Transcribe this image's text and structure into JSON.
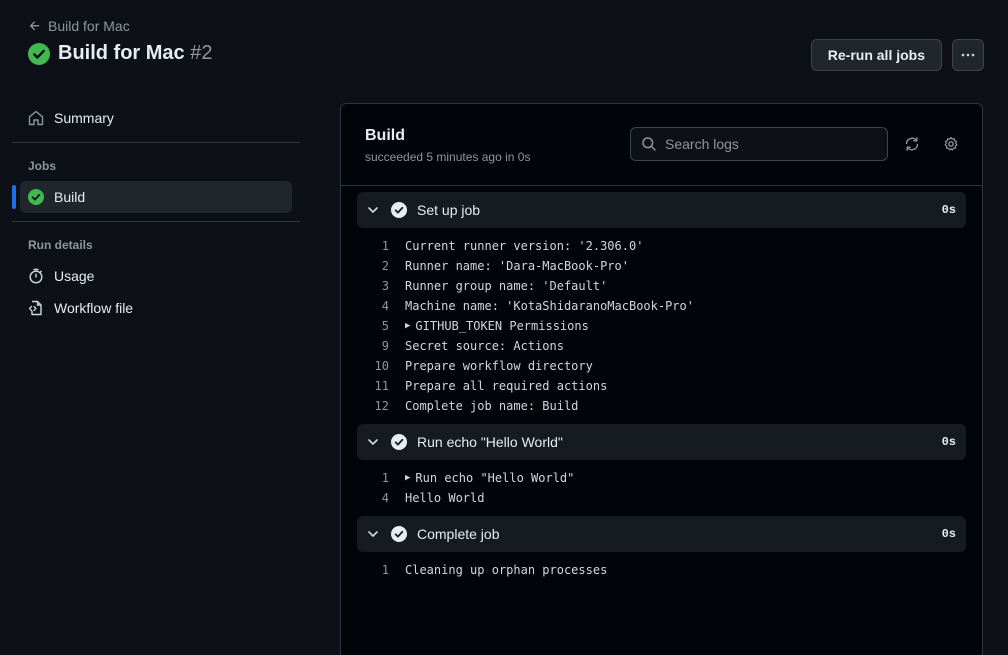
{
  "header": {
    "back_label": "Build for Mac",
    "title": "Build for Mac",
    "run_number": "#2",
    "rerun_label": "Re-run all jobs",
    "more_label": "···"
  },
  "sidebar": {
    "summary_label": "Summary",
    "jobs_heading": "Jobs",
    "job_label": "Build",
    "run_details_heading": "Run details",
    "usage_label": "Usage",
    "workflow_file_label": "Workflow file"
  },
  "job": {
    "title": "Build",
    "subtitle": "succeeded 5 minutes ago in 0s",
    "search_placeholder": "Search logs"
  },
  "steps": [
    {
      "name": "Set up job",
      "duration": "0s",
      "lines": [
        {
          "n": "1",
          "text": "Current runner version: '2.306.0'",
          "expandable": false
        },
        {
          "n": "2",
          "text": "Runner name: 'Dara-MacBook-Pro'",
          "expandable": false
        },
        {
          "n": "3",
          "text": "Runner group name: 'Default'",
          "expandable": false
        },
        {
          "n": "4",
          "text": "Machine name: 'KotaShidaranoMacBook-Pro'",
          "expandable": false
        },
        {
          "n": "5",
          "text": "GITHUB_TOKEN Permissions",
          "expandable": true
        },
        {
          "n": "9",
          "text": "Secret source: Actions",
          "expandable": false
        },
        {
          "n": "10",
          "text": "Prepare workflow directory",
          "expandable": false
        },
        {
          "n": "11",
          "text": "Prepare all required actions",
          "expandable": false
        },
        {
          "n": "12",
          "text": "Complete job name: Build",
          "expandable": false
        }
      ]
    },
    {
      "name": "Run echo \"Hello World\"",
      "duration": "0s",
      "lines": [
        {
          "n": "1",
          "text": "Run echo \"Hello World\"",
          "expandable": true
        },
        {
          "n": "4",
          "text": "Hello World",
          "expandable": false
        }
      ]
    },
    {
      "name": "Complete job",
      "duration": "0s",
      "lines": [
        {
          "n": "1",
          "text": "Cleaning up orphan processes",
          "expandable": false
        }
      ]
    }
  ],
  "colors": {
    "success": "#3fb950",
    "accent": "#1f6feb",
    "background": "#0d1117"
  }
}
